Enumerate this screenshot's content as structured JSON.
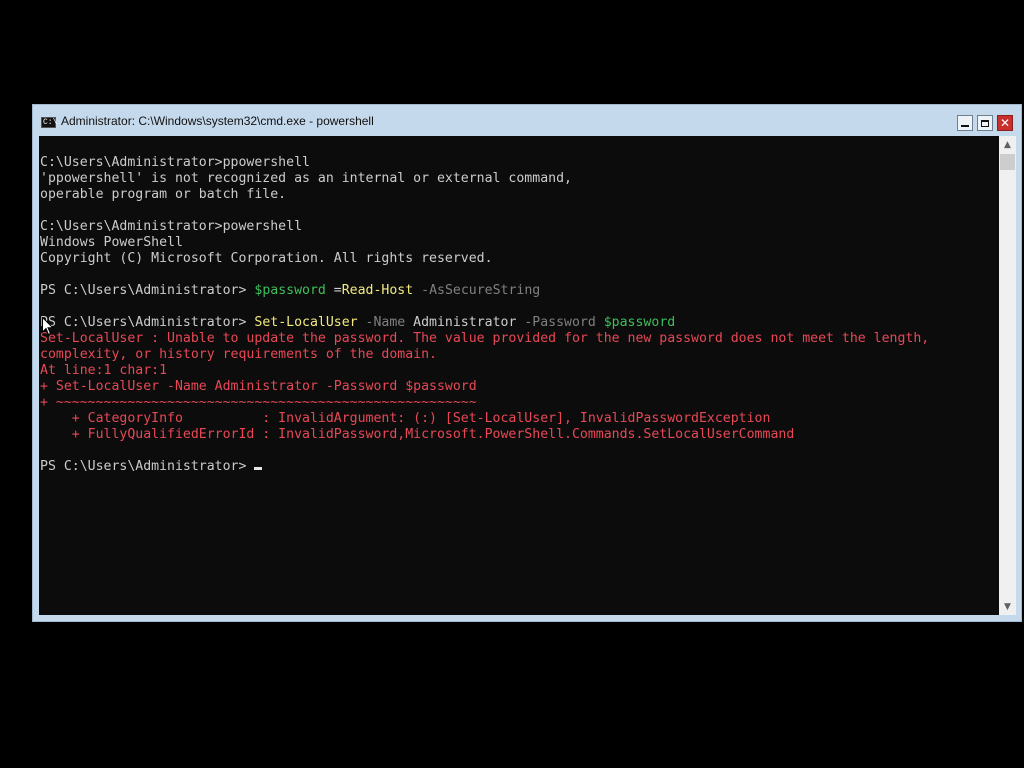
{
  "window": {
    "title": "Administrator: C:\\Windows\\system32\\cmd.exe - powershell",
    "icon": "console-icon",
    "controls": {
      "minimize": "minimize-icon",
      "maximize": "maximize-icon",
      "close": "close-icon"
    }
  },
  "console": {
    "colors": {
      "background": "#0c0c0c",
      "text": "#cccccc",
      "command": "#f2ea80",
      "variable": "#3fbf5a",
      "parameter": "#808080",
      "error": "#e74856"
    },
    "lines": [
      [
        {
          "t": "C:\\Users\\Administrator>ppowershell",
          "c": "prompt"
        }
      ],
      [
        {
          "t": "'ppowershell' is not recognized as an internal or external command,",
          "c": "prompt"
        }
      ],
      [
        {
          "t": "operable program or batch file.",
          "c": "prompt"
        }
      ],
      [],
      [
        {
          "t": "C:\\Users\\Administrator>powershell",
          "c": "prompt"
        }
      ],
      [
        {
          "t": "Windows PowerShell",
          "c": "prompt"
        }
      ],
      [
        {
          "t": "Copyright (C) Microsoft Corporation. All rights reserved.",
          "c": "prompt"
        }
      ],
      [],
      [
        {
          "t": "PS C:\\Users\\Administrator> ",
          "c": "prompt"
        },
        {
          "t": "$password",
          "c": "var"
        },
        {
          "t": " =",
          "c": "op"
        },
        {
          "t": "Read-Host",
          "c": "cmd"
        },
        {
          "t": " -AsSecureString",
          "c": "param"
        }
      ],
      [],
      [
        {
          "t": "PS C:\\Users\\Administrator> ",
          "c": "prompt"
        },
        {
          "t": "Set-LocalUser",
          "c": "cmd"
        },
        {
          "t": " -Name",
          "c": "param"
        },
        {
          "t": " Administrator",
          "c": "op"
        },
        {
          "t": " -Password",
          "c": "param"
        },
        {
          "t": " $password",
          "c": "var"
        }
      ],
      [
        {
          "t": "Set-LocalUser : Unable to update the password. The value provided for the new password does not meet the length,",
          "c": "err"
        }
      ],
      [
        {
          "t": "complexity, or history requirements of the domain.",
          "c": "err"
        }
      ],
      [
        {
          "t": "At line:1 char:1",
          "c": "err"
        }
      ],
      [
        {
          "t": "+ Set-LocalUser -Name Administrator -Password $password",
          "c": "err"
        }
      ],
      [
        {
          "t": "+ ~~~~~~~~~~~~~~~~~~~~~~~~~~~~~~~~~~~~~~~~~~~~~~~~~~~~~",
          "c": "err"
        }
      ],
      [
        {
          "t": "    + CategoryInfo          : InvalidArgument: (:) [Set-LocalUser], InvalidPasswordException",
          "c": "err"
        }
      ],
      [
        {
          "t": "    + FullyQualifiedErrorId : InvalidPassword,Microsoft.PowerShell.Commands.SetLocalUserCommand",
          "c": "err"
        }
      ],
      [],
      [
        {
          "t": "PS C:\\Users\\Administrator> ",
          "c": "prompt",
          "cursor": true
        }
      ]
    ]
  },
  "scrollbar": {
    "up_icon": "scroll-up-arrow-icon",
    "down_icon": "scroll-down-arrow-icon"
  },
  "pointer": "mouse-pointer-icon"
}
